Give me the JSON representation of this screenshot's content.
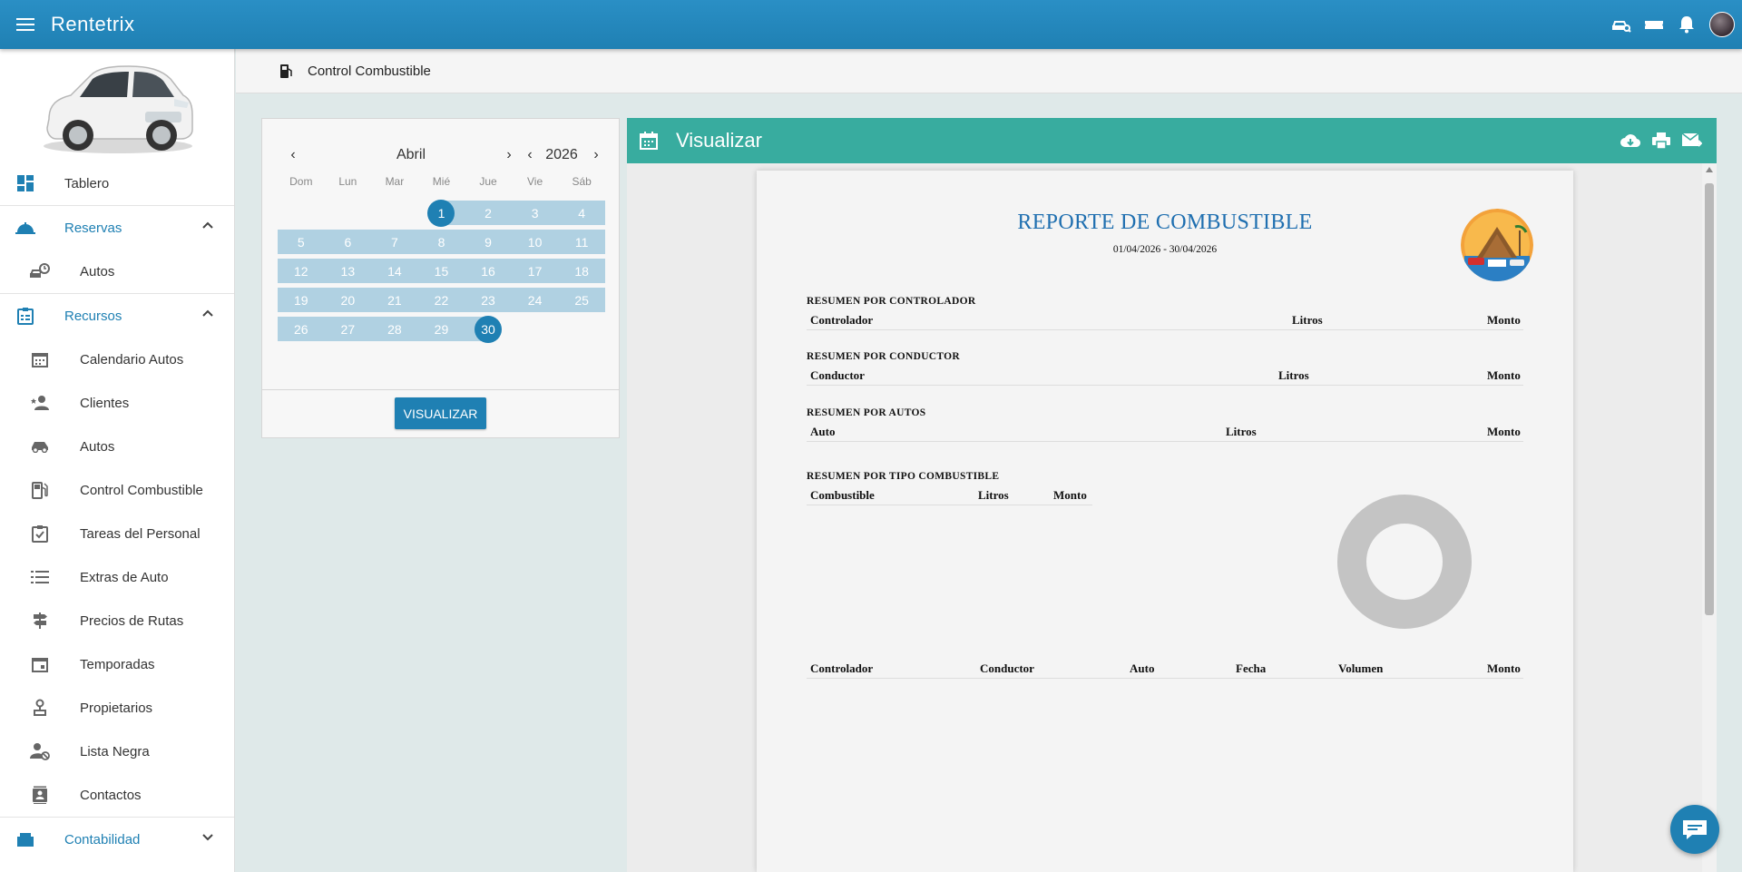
{
  "app": {
    "title": "Rentetrix"
  },
  "topbar": {
    "icons": [
      "car-search-icon",
      "ticket-icon",
      "bell-icon",
      "avatar"
    ]
  },
  "sidebar": {
    "items": [
      {
        "label": "Tablero",
        "icon": "dashboard-icon"
      },
      {
        "label": "Reservas",
        "icon": "bell-service-icon",
        "group": true,
        "expanded": true
      },
      {
        "label": "Autos",
        "icon": "car-clock-icon"
      },
      {
        "label": "Recursos",
        "icon": "clipboard-icon",
        "group": true,
        "expanded": true
      },
      {
        "label": "Calendario Autos",
        "icon": "calendar-icon"
      },
      {
        "label": "Clientes",
        "icon": "user-star-icon"
      },
      {
        "label": "Autos",
        "icon": "car-icon"
      },
      {
        "label": "Control Combustible",
        "icon": "fuel-icon"
      },
      {
        "label": "Tareas del Personal",
        "icon": "clipboard-check-icon"
      },
      {
        "label": "Extras de Auto",
        "icon": "list-icon"
      },
      {
        "label": "Precios de Rutas",
        "icon": "signpost-icon"
      },
      {
        "label": "Temporadas",
        "icon": "calendar-season-icon"
      },
      {
        "label": "Propietarios",
        "icon": "owner-icon"
      },
      {
        "label": "Lista Negra",
        "icon": "user-block-icon"
      },
      {
        "label": "Contactos",
        "icon": "contact-icon"
      },
      {
        "label": "Contabilidad",
        "icon": "accounting-icon",
        "group": true,
        "expanded": false
      }
    ]
  },
  "breadcrumb": {
    "label": "Control Combustible"
  },
  "calendar": {
    "month": "Abril",
    "year": "2026",
    "weekdays": [
      "Dom",
      "Lun",
      "Mar",
      "Mié",
      "Jue",
      "Vie",
      "Sáb"
    ],
    "range_start": "1",
    "range_end": "30",
    "button_label": "VISUALIZAR"
  },
  "viewer": {
    "title": "Visualizar"
  },
  "report": {
    "title": "REPORTE DE COMBUSTIBLE",
    "date_range": "01/04/2026 - 30/04/2026",
    "s1": {
      "title": "RESUMEN POR CONTROLADOR",
      "c1": "Controlador",
      "c2": "Litros",
      "c3": "Monto"
    },
    "s2": {
      "title": "RESUMEN POR CONDUCTOR",
      "c1": "Conductor",
      "c2": "Litros",
      "c3": "Monto"
    },
    "s3": {
      "title": "RESUMEN POR AUTOS",
      "c1": "Auto",
      "c2": "Litros",
      "c3": "Monto"
    },
    "s4": {
      "title": "RESUMEN POR TIPO COMBUSTIBLE",
      "c1": "Combustible",
      "c2": "Litros",
      "c3": "Monto"
    },
    "detail": {
      "c1": "Controlador",
      "c2": "Conductor",
      "c3": "Auto",
      "c4": "Fecha",
      "c5": "Volumen",
      "c6": "Monto"
    }
  },
  "colors": {
    "primary": "#1f80b3",
    "teal": "#38ac9f",
    "range": "#b0d1e2",
    "report_title": "#1f6fb0"
  }
}
